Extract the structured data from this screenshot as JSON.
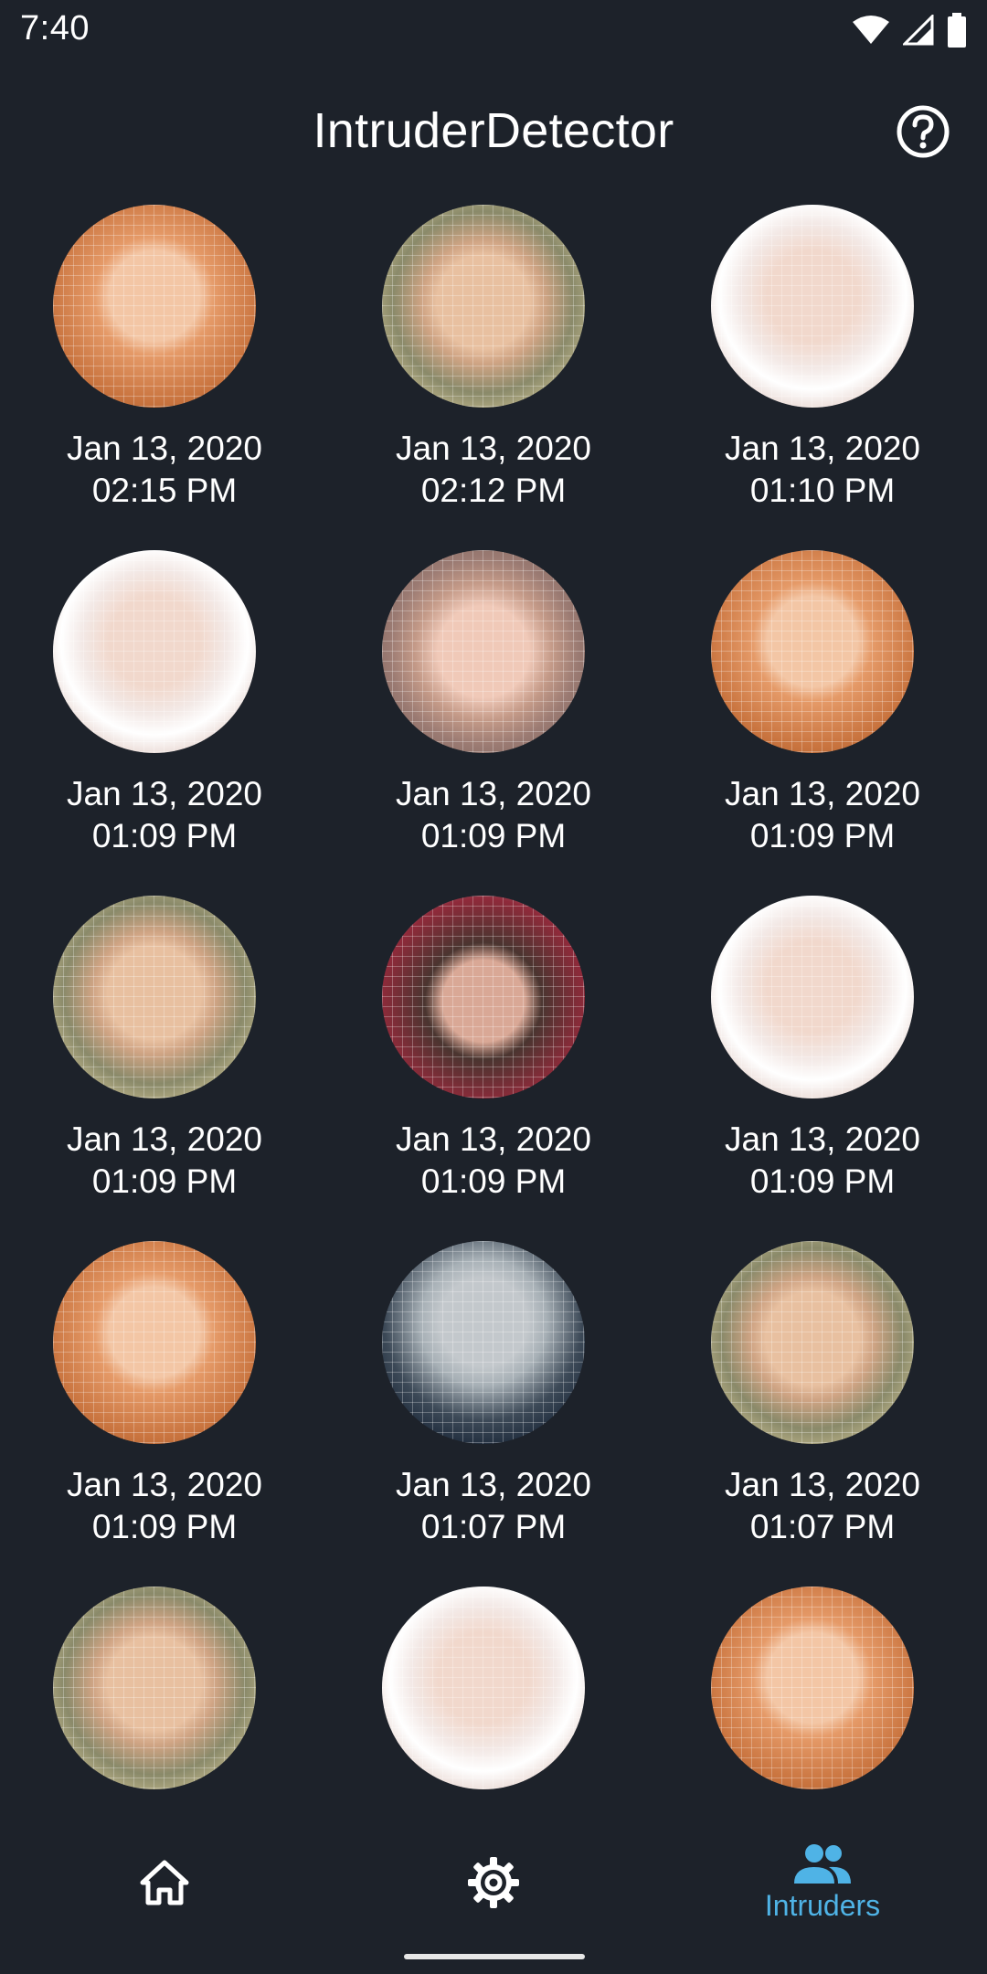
{
  "status_bar": {
    "time": "7:40"
  },
  "app_bar": {
    "title": "IntruderDetector",
    "help_icon": "help-circle-icon"
  },
  "intruders": [
    {
      "date": "Jan 13, 2020",
      "time": "02:15 PM",
      "face": "f-red"
    },
    {
      "date": "Jan 13, 2020",
      "time": "02:12 PM",
      "face": "f-bald"
    },
    {
      "date": "Jan 13, 2020",
      "time": "01:10 PM",
      "face": "f-grey"
    },
    {
      "date": "Jan 13, 2020",
      "time": "01:09 PM",
      "face": "f-grey"
    },
    {
      "date": "Jan 13, 2020",
      "time": "01:09 PM",
      "face": "f-glass"
    },
    {
      "date": "Jan 13, 2020",
      "time": "01:09 PM",
      "face": "f-red"
    },
    {
      "date": "Jan 13, 2020",
      "time": "01:09 PM",
      "face": "f-bald"
    },
    {
      "date": "Jan 13, 2020",
      "time": "01:09 PM",
      "face": "f-dark"
    },
    {
      "date": "Jan 13, 2020",
      "time": "01:09 PM",
      "face": "f-grey"
    },
    {
      "date": "Jan 13, 2020",
      "time": "01:09 PM",
      "face": "f-red"
    },
    {
      "date": "Jan 13, 2020",
      "time": "01:07 PM",
      "face": "f-coat"
    },
    {
      "date": "Jan 13, 2020",
      "time": "01:07 PM",
      "face": "f-bald"
    },
    {
      "date": "",
      "time": "",
      "face": "f-bald"
    },
    {
      "date": "",
      "time": "",
      "face": "f-grey"
    },
    {
      "date": "",
      "time": "",
      "face": "f-red"
    }
  ],
  "bottom_nav": {
    "items": [
      {
        "name": "home",
        "icon": "home-icon",
        "label": ""
      },
      {
        "name": "settings",
        "icon": "gear-icon",
        "label": ""
      },
      {
        "name": "intruders",
        "icon": "people-icon",
        "label": "Intruders",
        "active": true
      }
    ],
    "active_color": "#4fb3e6"
  },
  "colors": {
    "background": "#1d222a",
    "text": "#ffffff",
    "accent": "#4fb3e6"
  }
}
